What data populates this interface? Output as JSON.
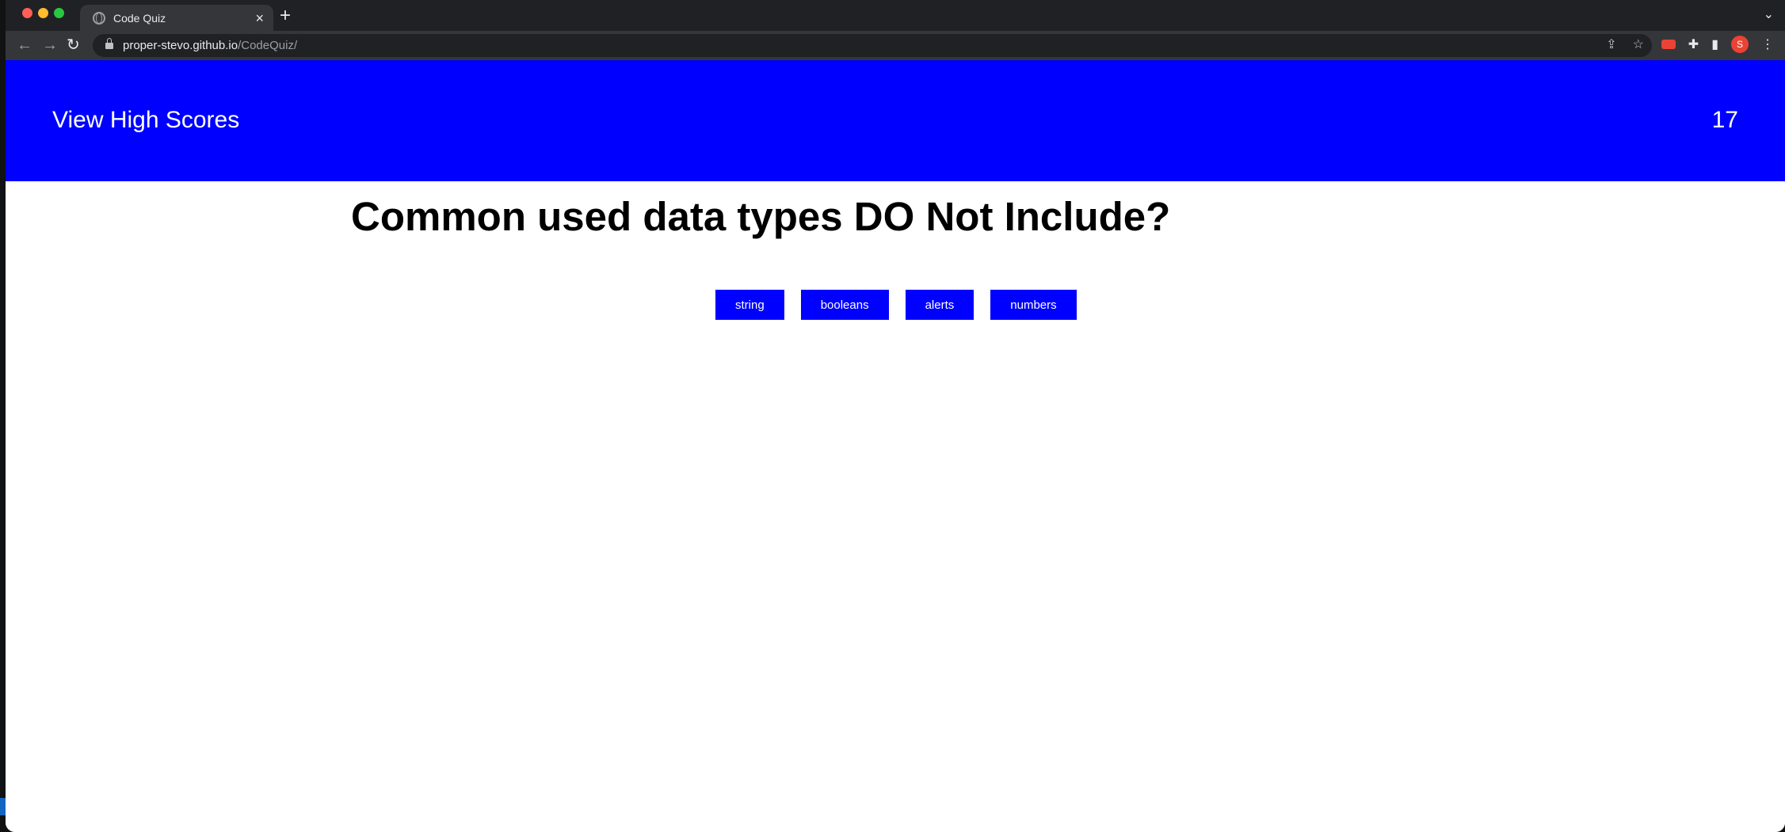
{
  "browser": {
    "tab_title": "Code Quiz",
    "tab_close": "×",
    "new_tab": "+",
    "tab_menu": "⌄",
    "url_host": "proper-stevo.github.io",
    "url_path": "/CodeQuiz/",
    "avatar_letter": "S"
  },
  "header": {
    "view_high_scores": "View High Scores",
    "timer": "17"
  },
  "quiz": {
    "question": "Common used data types DO Not Include?",
    "choices": [
      "string",
      "booleans",
      "alerts",
      "numbers"
    ]
  },
  "colors": {
    "header_bg": "#0000ff",
    "button_bg": "#0000ff"
  }
}
